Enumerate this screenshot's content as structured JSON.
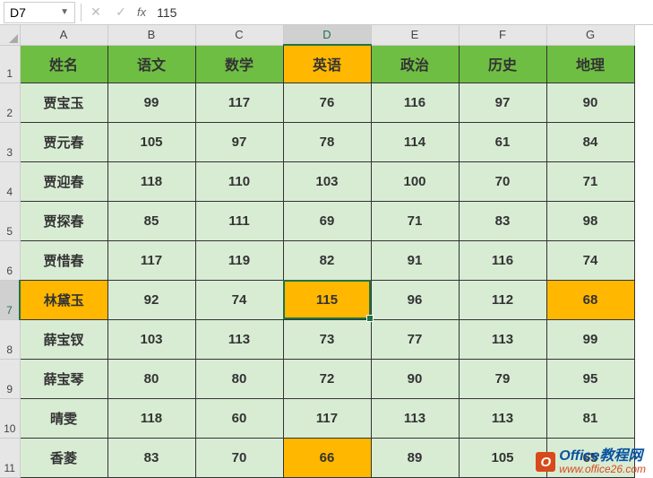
{
  "formula_bar": {
    "name_box": "D7",
    "formula_value": "115",
    "fx_label": "fx"
  },
  "columns": [
    "A",
    "B",
    "C",
    "D",
    "E",
    "F",
    "G"
  ],
  "active_column": "D",
  "active_row": 7,
  "row_numbers": [
    "1",
    "2",
    "3",
    "4",
    "5",
    "6",
    "7",
    "8",
    "9",
    "10",
    "11"
  ],
  "chart_data": {
    "type": "table",
    "headers": [
      "姓名",
      "语文",
      "数学",
      "英语",
      "政治",
      "历史",
      "地理"
    ],
    "rows": [
      [
        "贾宝玉",
        "99",
        "117",
        "76",
        "116",
        "97",
        "90"
      ],
      [
        "贾元春",
        "105",
        "97",
        "78",
        "114",
        "61",
        "84"
      ],
      [
        "贾迎春",
        "118",
        "110",
        "103",
        "100",
        "70",
        "71"
      ],
      [
        "贾探春",
        "85",
        "111",
        "69",
        "71",
        "83",
        "98"
      ],
      [
        "贾惜春",
        "117",
        "119",
        "82",
        "91",
        "116",
        "74"
      ],
      [
        "林黛玉",
        "92",
        "74",
        "115",
        "96",
        "112",
        "68"
      ],
      [
        "薛宝钗",
        "103",
        "113",
        "73",
        "77",
        "113",
        "99"
      ],
      [
        "薛宝琴",
        "80",
        "80",
        "72",
        "90",
        "79",
        "95"
      ],
      [
        "晴雯",
        "118",
        "60",
        "117",
        "113",
        "113",
        "81"
      ],
      [
        "香菱",
        "83",
        "70",
        "66",
        "89",
        "105",
        "65"
      ]
    ]
  },
  "highlights": {
    "header_col_orange": "D",
    "row_orange": 7,
    "active_cell": "D7",
    "extra_orange_cells": [
      "D11",
      "G7"
    ]
  },
  "watermark": {
    "icon_letter": "O",
    "title": "Office教程网",
    "url": "www.office26.com"
  }
}
